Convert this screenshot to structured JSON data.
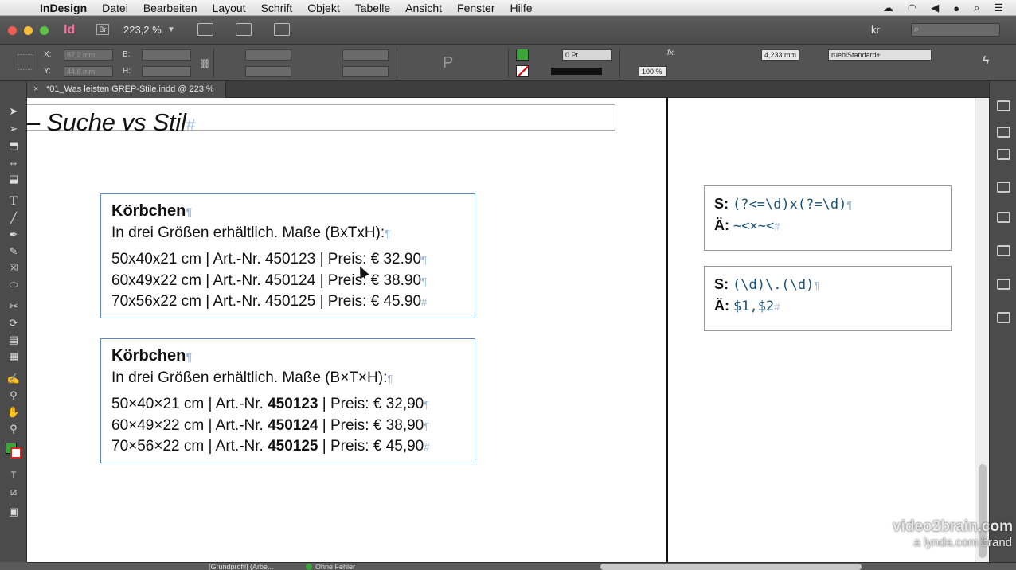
{
  "menubar": {
    "app": "InDesign",
    "items": [
      "Datei",
      "Bearbeiten",
      "Layout",
      "Schrift",
      "Objekt",
      "Tabelle",
      "Ansicht",
      "Fenster",
      "Hilfe"
    ]
  },
  "appbar": {
    "logo": "Id",
    "bridge": "Br",
    "zoom": "223,2 %",
    "workspace": "kr"
  },
  "control": {
    "x_label": "X:",
    "x_value": "87,2 mm",
    "y_label": "Y:",
    "y_value": "44,8 mm",
    "b_label": "B:",
    "h_label": "H:",
    "stroke_weight": "0 Pt",
    "opacity": "100 %",
    "size": "4,233 mm",
    "object_style": "ruebiStandard+"
  },
  "tab": {
    "title": "*01_Was leisten GREP-Stile.indd @ 223 %",
    "close": "×"
  },
  "page": {
    "headline": "– Suche vs Stil",
    "headline_mark": "#",
    "box1": {
      "title": "Körbchen",
      "intro": "In drei Größen erhältlich. Maße (BxTxH):",
      "rows": [
        "50x40x21 cm | Art.-Nr. 450123 | Preis: € 32.90",
        "60x49x22 cm | Art.-Nr. 450124 | Preis: € 38.90",
        "70x56x22 cm | Art.-Nr. 450125 | Preis: € 45.90"
      ]
    },
    "box2": {
      "title": "Körbchen",
      "intro": "In drei Größen erhältlich. Maße (B×T×H):",
      "rows": [
        {
          "pre": "50×40×21 cm | Art.-Nr. ",
          "num": "450123",
          "post": " | Preis: € 32,90"
        },
        {
          "pre": "60×49×22 cm | Art.-Nr. ",
          "num": "450124",
          "post": " | Preis: € 38,90"
        },
        {
          "pre": "70×56×22 cm | Art.-Nr. ",
          "num": "450125",
          "post": " | Preis: € 45,90"
        }
      ]
    },
    "pilcrow": "¶",
    "end_mark": "#",
    "regex1": {
      "s_label": "S:",
      "s_value": "(?<=\\d)x(?=\\d)",
      "a_label": "Ä:",
      "a_value": "~<×~<"
    },
    "regex2": {
      "s_label": "S:",
      "s_value": "(\\d)\\.(\\d)",
      "a_label": "Ä:",
      "a_value": "$1,$2"
    }
  },
  "status": {
    "profile": "[Grundprofil] (Arbe...",
    "errors": "Ohne Fehler"
  },
  "watermark": {
    "line1": "video2brain.com",
    "line2": "a lynda.com brand"
  },
  "colors": {
    "frame_blue": "#5b8bbd",
    "hidden_char": "#9bb6d9",
    "fill_green": "#3aa63a",
    "regex_code": "#1a5276"
  }
}
